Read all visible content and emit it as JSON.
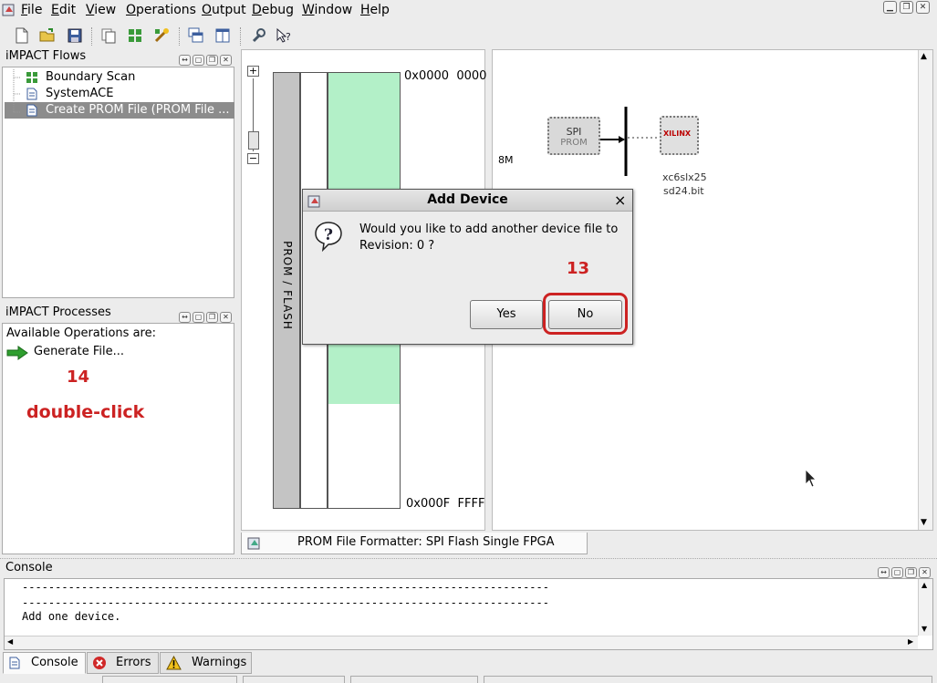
{
  "menu": [
    "File",
    "Edit",
    "View",
    "Operations",
    "Output",
    "Debug",
    "Window",
    "Help"
  ],
  "flows_panel": {
    "title": "iMPACT Flows",
    "items": [
      {
        "label": "Boundary Scan"
      },
      {
        "label": "SystemACE"
      },
      {
        "label": "Create PROM File (PROM File ..."
      }
    ]
  },
  "processes_panel": {
    "title": "iMPACT Processes",
    "available_label": "Available Operations are:",
    "operation": "Generate File..."
  },
  "annotations": {
    "step_14": "14",
    "double_click": "double-click",
    "step_13": "13"
  },
  "prom_view": {
    "start_address": "0x0000  0000",
    "end_address": "0x000F  FFFF",
    "vertical_label": "PROM / FLASH",
    "fill_fraction": 0.76
  },
  "device_view": {
    "size_label": "8M",
    "spi_label": "SPI",
    "prom_label": "PROM",
    "xilinx_label": "XILINX",
    "file_name_line1": "xc6slx25",
    "file_name_line2": "sd24.bit"
  },
  "formatter_tab": "PROM File Formatter: SPI Flash Single FPGA",
  "dialog": {
    "title": "Add Device",
    "message_line1": "Would you like to add another device file to",
    "message_line2": "Revision: 0 ?",
    "yes": "Yes",
    "no": "No",
    "close": "×"
  },
  "console": {
    "title": "Console",
    "lines": [
      "--------------------------------------------------------------------------------",
      "--------------------------------------------------------------------------------",
      "Add one device."
    ]
  },
  "bottom_tabs": [
    "Console",
    "Errors",
    "Warnings"
  ],
  "colors": {
    "accent_red": "#cc2222",
    "selection": "#8c8c8c",
    "prom_fill": "#b3f0c8"
  }
}
